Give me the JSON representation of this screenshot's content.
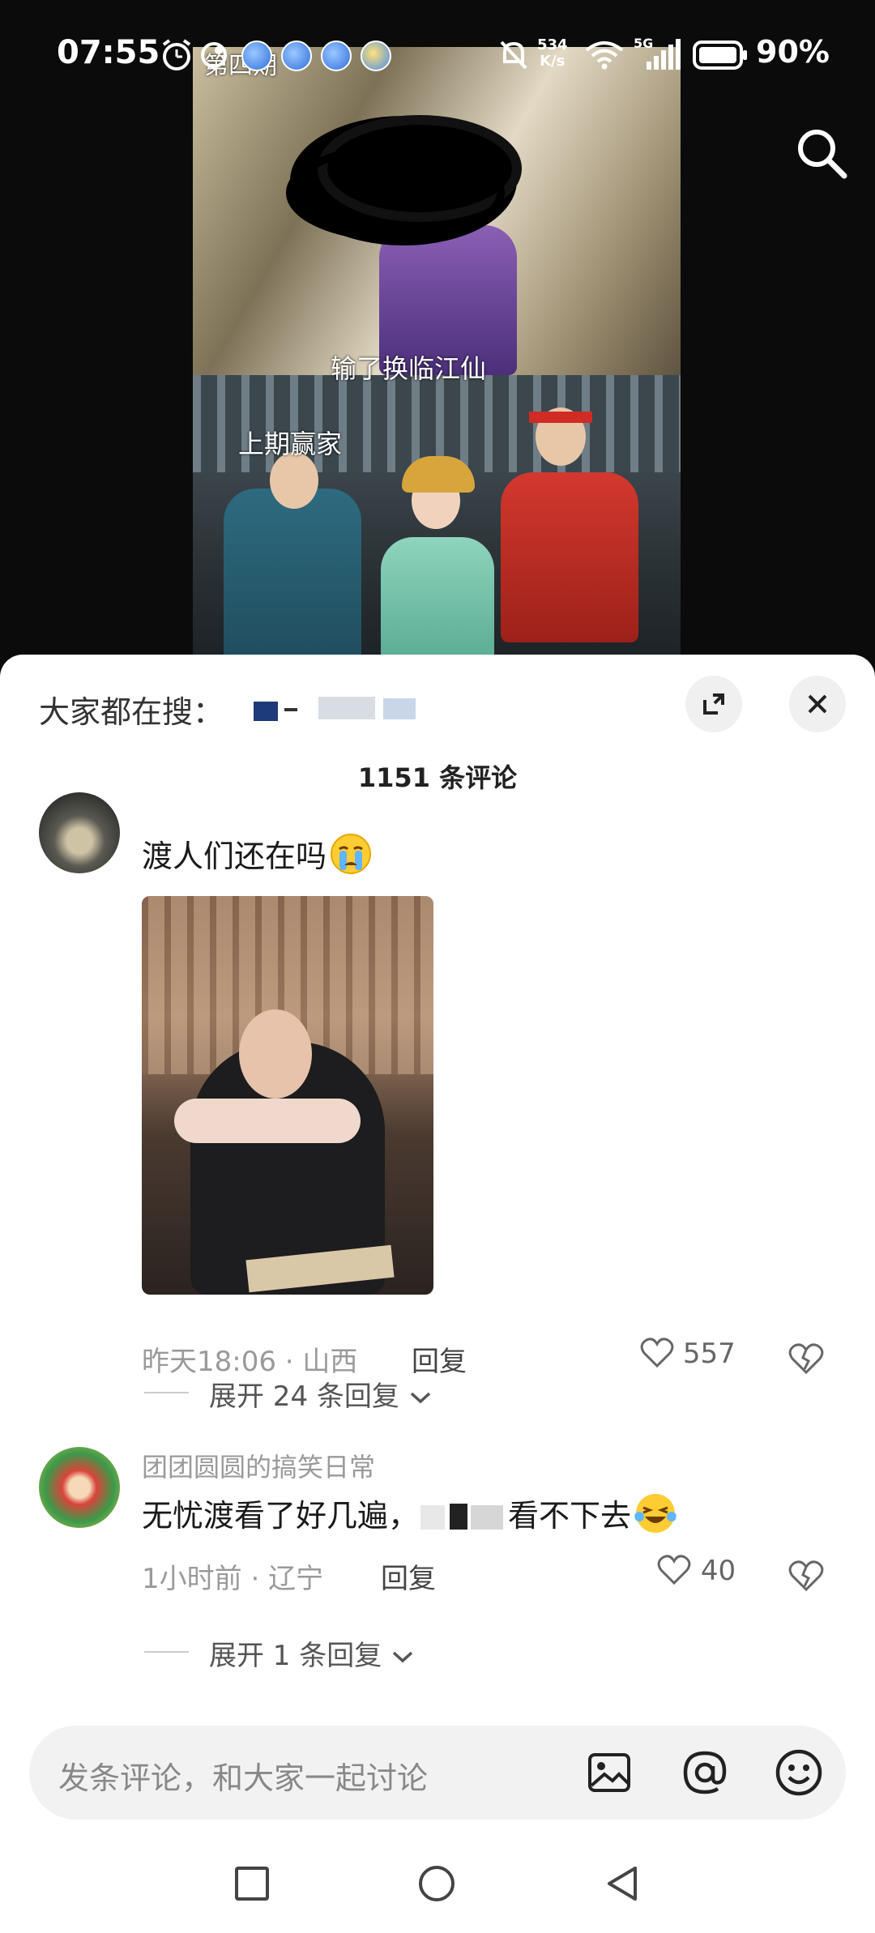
{
  "status_bar": {
    "time": "07:55",
    "net_speed_value": "534",
    "net_speed_unit": "K/s",
    "network_type": "5G",
    "battery": "90%",
    "icons": [
      "alarm-icon",
      "app-notification-icon",
      "mute-icon",
      "wifi-icon",
      "signal-icon",
      "battery-icon"
    ]
  },
  "video": {
    "overlay_episode": "第四期",
    "overlay_loser": "输了换临江仙",
    "overlay_winner": "上期赢家"
  },
  "comments_panel": {
    "trending_label": "大家都在搜：",
    "count_label": "1151 条评论",
    "comments": [
      {
        "text": "渡人们还在吗",
        "emoji": "crying-face",
        "time": "昨天18:06",
        "location": "山西",
        "reply_label": "回复",
        "likes": "557",
        "expand_label": "展开 24 条回复"
      },
      {
        "username": "团团圆圆的搞笑日常",
        "text": "无忧渡看了好几遍，",
        "text_tail": "看不下去",
        "emoji": "laughing-tears-face",
        "time": "1小时前",
        "location": "辽宁",
        "reply_label": "回复",
        "likes": "40",
        "expand_label": "展开 1 条回复"
      }
    ]
  },
  "input_bar": {
    "placeholder": "发条评论，和大家一起讨论"
  },
  "colors": {
    "sheet_bg": "#ffffff",
    "meta_text": "#9a9a9a",
    "input_bg": "#f2f2f2"
  }
}
